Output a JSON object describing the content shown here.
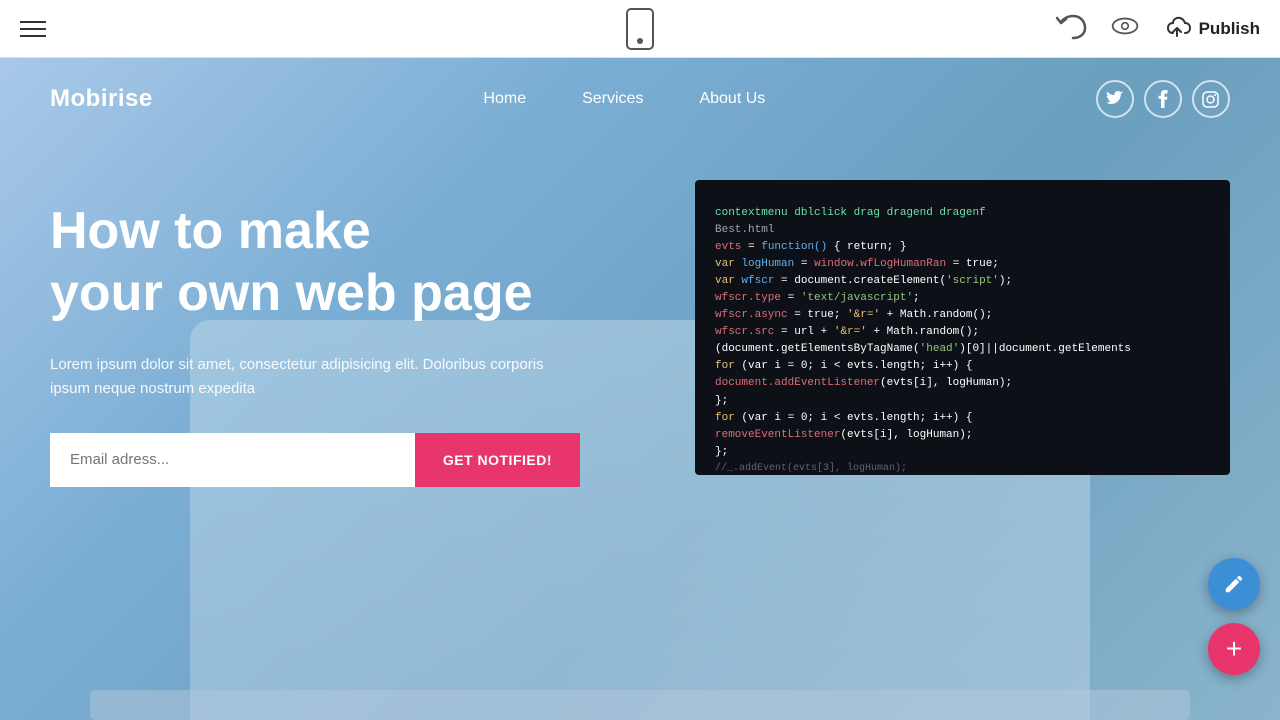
{
  "toolbar": {
    "publish_label": "Publish"
  },
  "website": {
    "logo": "Mobirise",
    "nav": {
      "links": [
        {
          "label": "Home"
        },
        {
          "label": "Services"
        },
        {
          "label": "About Us"
        }
      ],
      "social": [
        {
          "label": "T",
          "name": "twitter"
        },
        {
          "label": "f",
          "name": "facebook"
        },
        {
          "label": "ig",
          "name": "instagram"
        }
      ]
    },
    "hero": {
      "title_line1": "How to make",
      "title_line2": "your own web page",
      "subtitle": "Lorem ipsum dolor sit amet, consectetur adipisicing elit. Doloribus corporis ipsum neque nostrum expedita",
      "email_placeholder": "Email adress...",
      "cta_label": "GET NOTIFIED!"
    }
  },
  "fab": {
    "add_label": "+"
  }
}
